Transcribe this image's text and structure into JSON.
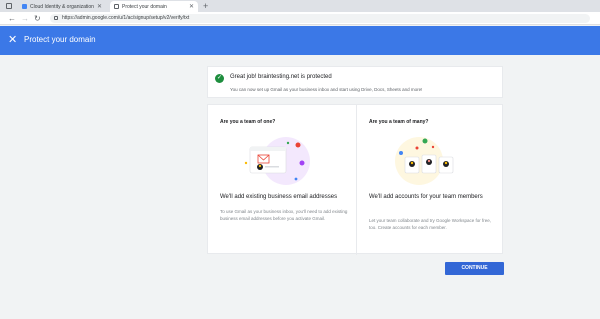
{
  "browser": {
    "tabs": [
      {
        "title": "Cloud Identity & organization -",
        "active": false
      },
      {
        "title": "Protect your domain",
        "active": true
      }
    ],
    "new_tab": "+",
    "back": "←",
    "forward": "→",
    "reload": "↻",
    "url": "https://admin.google.com/u/1/ac/signup/setup/v2/verify/txt"
  },
  "appbar": {
    "close": "✕",
    "title": "Protect your domain",
    "color": "#3b78e7"
  },
  "banner": {
    "check": "✓",
    "heading": "Great job! braintesting.net is protected",
    "sub": "You can now set up Gmail as your business inbox and start using Drive, Docs, Sheets and more!"
  },
  "options": [
    {
      "question": "Are you a team of one?",
      "heading": "We'll add existing business email addresses",
      "desc": "To use Gmail as your business inbox, you'll need to add existing business email addresses before you activate Gmail."
    },
    {
      "question": "Are you a team of many?",
      "heading": "We'll add accounts for your team members",
      "desc": "Let your team collaborate and try Google Workspace for free, too. Create accounts for each member."
    }
  ],
  "continue_label": "CONTINUE"
}
